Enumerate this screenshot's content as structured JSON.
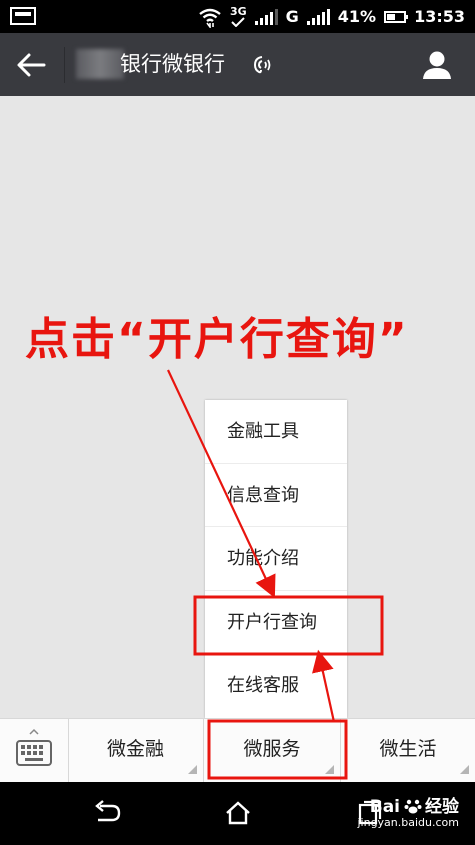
{
  "status_bar": {
    "network": "3G",
    "carrier": "G",
    "battery": "41%",
    "time": "13:53"
  },
  "header": {
    "title": "银行微银行",
    "icons": [
      "back-arrow-icon",
      "voice-icon",
      "user-icon"
    ]
  },
  "annotation": {
    "instruction": "点击“开户行查询”"
  },
  "popup_menu": {
    "items": [
      "金融工具",
      "信息查询",
      "功能介绍",
      "开户行查询",
      "在线客服"
    ],
    "highlighted": "开户行查询"
  },
  "bottom_menu": {
    "tabs": [
      "微金融",
      "微服务",
      "微生活"
    ],
    "highlighted": "微服务"
  },
  "watermark": {
    "brand": "Bai",
    "product": "经验",
    "url": "jingyan.baidu.com"
  },
  "colors": {
    "annotation_red": "#e8150f",
    "header_bg": "#393a3f",
    "content_bg": "#e6e6e6"
  }
}
